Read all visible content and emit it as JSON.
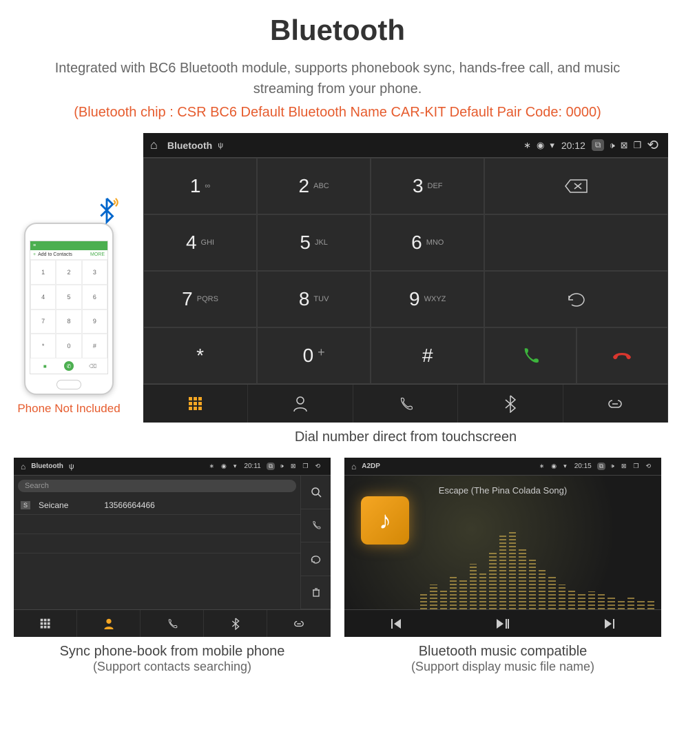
{
  "title": "Bluetooth",
  "subtitle": "Integrated with BC6 Bluetooth module, supports phonebook sync, hands-free call, and music streaming from your phone.",
  "specs": "(Bluetooth chip : CSR BC6     Default Bluetooth Name CAR-KIT     Default Pair Code: 0000)",
  "phone": {
    "caption": "Phone Not Included",
    "top_add": "Add to Contacts",
    "top_more": "MORE",
    "keys": [
      "1",
      "2",
      "3",
      "4",
      "5",
      "6",
      "7",
      "8",
      "9",
      "*",
      "0",
      "#"
    ]
  },
  "main": {
    "app": "Bluetooth",
    "time": "20:12",
    "keys": [
      {
        "n": "1",
        "l": "∞"
      },
      {
        "n": "2",
        "l": "ABC"
      },
      {
        "n": "3",
        "l": "DEF"
      },
      {
        "n": "4",
        "l": "GHI"
      },
      {
        "n": "5",
        "l": "JKL"
      },
      {
        "n": "6",
        "l": "MNO"
      },
      {
        "n": "7",
        "l": "PQRS"
      },
      {
        "n": "8",
        "l": "TUV"
      },
      {
        "n": "9",
        "l": "WXYZ"
      },
      {
        "n": "*",
        "l": ""
      },
      {
        "n": "0",
        "l": "+"
      },
      {
        "n": "#",
        "l": ""
      }
    ],
    "caption": "Dial number direct from touchscreen"
  },
  "phonebook": {
    "app": "Bluetooth",
    "time": "20:11",
    "search": "Search",
    "contact_badge": "S",
    "contact_name": "Seicane",
    "contact_number": "13566664466",
    "caption": "Sync phone-book from mobile phone",
    "caption_sub": "(Support contacts searching)"
  },
  "music": {
    "app": "A2DP",
    "time": "20:15",
    "track": "Escape (The Pina Colada Song)",
    "caption": "Bluetooth music compatible",
    "caption_sub": "(Support display music file name)"
  }
}
